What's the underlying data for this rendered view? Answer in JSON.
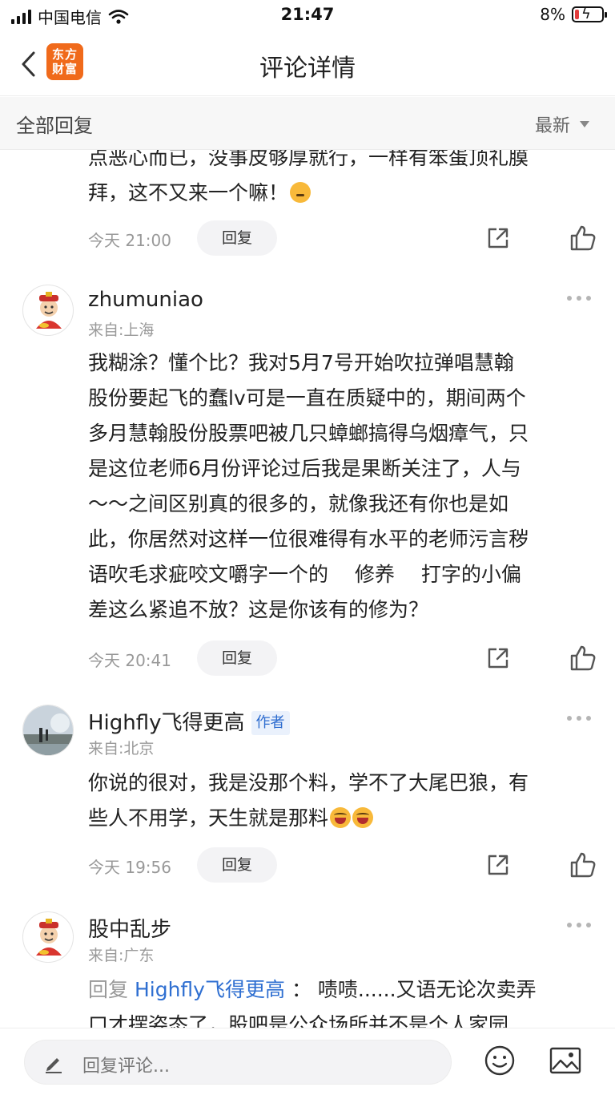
{
  "status_bar": {
    "carrier": "中国电信",
    "time": "21:47",
    "battery": "8%"
  },
  "nav": {
    "logo_line1": "东方",
    "logo_line2": "财富",
    "title": "评论详情"
  },
  "filter": {
    "left_label": "全部回复",
    "sort_label": "最新"
  },
  "comments": [
    {
      "line1": "点恶心而已，没事皮够厚就行，一样有笨蛋顶礼膜",
      "line2": "拜，这不又来一个嘛！",
      "time": "今天 21:00",
      "reply_label": "回复"
    },
    {
      "username": "zhumuniao",
      "origin": "来自:上海",
      "lines": [
        "我糊涂？懂个比？我对5月7号开始吹拉弹唱慧翰",
        "股份要起飞的蠢lv可是一直在质疑中的，期间两个",
        "多月慧翰股份股票吧被几只蟑螂搞得乌烟瘴气，只",
        "是这位老师6月份评论过后我是果断关注了，人与",
        "～～之间区别真的很多的，就像我还有你也是如",
        "此，你居然对这样一位很难得有水平的老师污言秽",
        "语吹毛求疵咬文嚼字一个的　 修养　 打字的小偏",
        "差这么紧追不放？这是你该有的修为？"
      ],
      "time": "今天 20:41",
      "reply_label": "回复"
    },
    {
      "username": "Highfly飞得更高",
      "badge": "作者",
      "origin": "来自:北京",
      "line1": "你说的很对，我是没那个料，学不了大尾巴狼，有",
      "line2": "些人不用学，天生就是那料",
      "time": "今天 19:56",
      "reply_label": "回复"
    },
    {
      "username": "股中乱步",
      "origin": "来自:广东",
      "reply_prefix": "回复",
      "reply_target": "Highfly飞得更高",
      "reply_text": "：  啧啧......又语无论次卖弄",
      "line2": "口才摆姿态了，股吧是公众场所并不是个人家园"
    }
  ],
  "bottom": {
    "placeholder": "回复评论..."
  }
}
